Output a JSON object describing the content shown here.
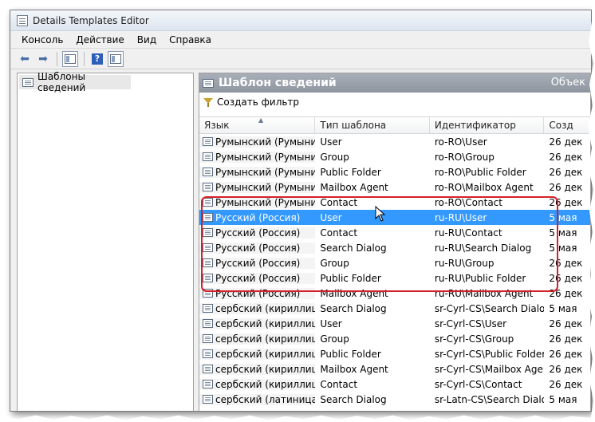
{
  "window": {
    "title": "Details Templates Editor"
  },
  "menu": [
    "Консоль",
    "Действие",
    "Вид",
    "Справка"
  ],
  "toolbar": {
    "back_icon": "back-arrow-icon",
    "forward_icon": "forward-arrow-icon",
    "help_label": "?"
  },
  "tree": {
    "root_label": "Шаблоны сведений"
  },
  "pane": {
    "title": "Шаблон сведений",
    "right_title": "Объек",
    "create_filter_label": "Создать фильтр"
  },
  "columns": [
    "Язык",
    "Тип шаблона",
    "Идентификатор",
    "Созд"
  ],
  "rows": [
    {
      "lang": "Румынский (Румыния)",
      "type": "User",
      "id": "ro-RO\\User",
      "created": "26 дек"
    },
    {
      "lang": "Румынский (Румыния)",
      "type": "Group",
      "id": "ro-RO\\Group",
      "created": "26 дек"
    },
    {
      "lang": "Румынский (Румыния)",
      "type": "Public Folder",
      "id": "ro-RO\\Public Folder",
      "created": "26 дек"
    },
    {
      "lang": "Румынский (Румыния)",
      "type": "Mailbox Agent",
      "id": "ro-RO\\Mailbox Agent",
      "created": "26 дек"
    },
    {
      "lang": "Румынский (Румыния)",
      "type": "Contact",
      "id": "ro-RO\\Contact",
      "created": "26 дек"
    },
    {
      "lang": "Русский (Россия)",
      "type": "User",
      "id": "ru-RU\\User",
      "created": "5 мая"
    },
    {
      "lang": "Русский (Россия)",
      "type": "Contact",
      "id": "ru-RU\\Contact",
      "created": "5 мая"
    },
    {
      "lang": "Русский (Россия)",
      "type": "Search Dialog",
      "id": "ru-RU\\Search Dialog",
      "created": "5 мая"
    },
    {
      "lang": "Русский (Россия)",
      "type": "Group",
      "id": "ru-RU\\Group",
      "created": "26 дек"
    },
    {
      "lang": "Русский (Россия)",
      "type": "Public Folder",
      "id": "ru-RU\\Public Folder",
      "created": "26 дек"
    },
    {
      "lang": "Русский (Россия)",
      "type": "Mailbox Agent",
      "id": "ru-RU\\Mailbox Agent",
      "created": "26 дек"
    },
    {
      "lang": "сербский (кириллиц...",
      "type": "Search Dialog",
      "id": "sr-Cyrl-CS\\Search Dialog",
      "created": "5 мая"
    },
    {
      "lang": "сербский (кириллиц...",
      "type": "User",
      "id": "sr-Cyrl-CS\\User",
      "created": "26 дек"
    },
    {
      "lang": "сербский (кириллиц...",
      "type": "Group",
      "id": "sr-Cyrl-CS\\Group",
      "created": "26 дек"
    },
    {
      "lang": "сербский (кириллиц...",
      "type": "Public Folder",
      "id": "sr-Cyrl-CS\\Public Folder",
      "created": "26 дек"
    },
    {
      "lang": "сербский (кириллиц...",
      "type": "Mailbox Agent",
      "id": "sr-Cyrl-CS\\Mailbox Agent",
      "created": "26 дек"
    },
    {
      "lang": "сербский (кириллиц...",
      "type": "Contact",
      "id": "sr-Cyrl-CS\\Contact",
      "created": "26 дек"
    },
    {
      "lang": "сербский (латиница...",
      "type": "Search Dialog",
      "id": "sr-Latn-CS\\Search Dialog",
      "created": "5 мая"
    }
  ],
  "selected_row_index": 5,
  "colors": {
    "selection": "#3399ff",
    "highlight_box": "#d4202a",
    "pane_header": "#9aa1ab"
  }
}
